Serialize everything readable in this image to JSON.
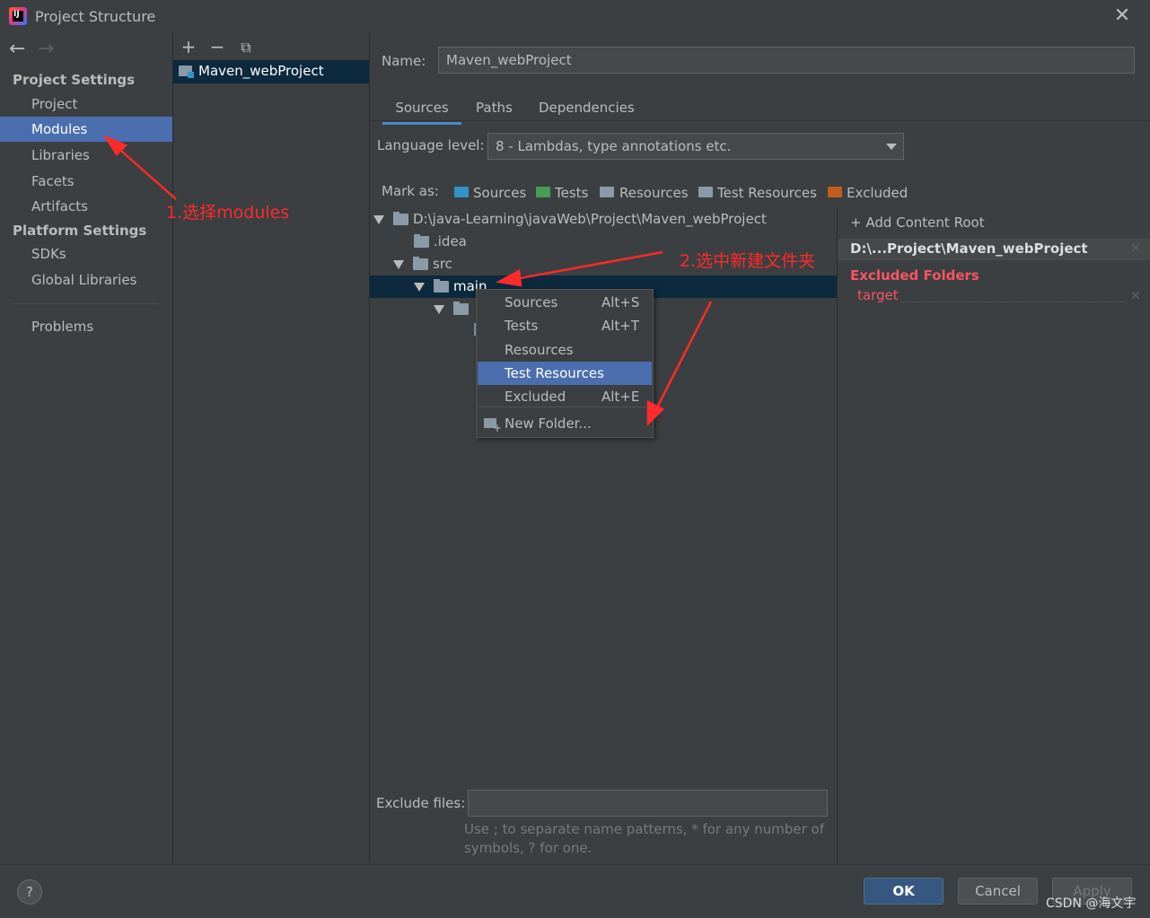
{
  "window": {
    "title": "Project Structure",
    "app_icon_letters": "IJ"
  },
  "nav": {
    "back_icon": "arrow-left-icon",
    "forward_icon": "arrow-right-icon",
    "project_settings_title": "Project Settings",
    "project_settings_items": [
      "Project",
      "Modules",
      "Libraries",
      "Facets",
      "Artifacts"
    ],
    "platform_settings_title": "Platform Settings",
    "platform_settings_items": [
      "SDKs",
      "Global Libraries"
    ],
    "problems": "Problems",
    "selected": "Modules"
  },
  "modules": {
    "toolbar": [
      "add-icon",
      "remove-icon",
      "copy-icon"
    ],
    "items": [
      "Maven_webProject"
    ]
  },
  "main": {
    "name_label": "Name:",
    "name_value": "Maven_webProject",
    "tabs": [
      "Sources",
      "Paths",
      "Dependencies"
    ],
    "active_tab": "Sources",
    "language_level_label": "Language level:",
    "language_level_value": "8 - Lambdas, type annotations etc.",
    "mark_as_label": "Mark as:",
    "mark_as": [
      {
        "label": "Sources",
        "color": "#3592c4"
      },
      {
        "label": "Tests",
        "color": "#499c54"
      },
      {
        "label": "Resources",
        "color": "#8a9aa8"
      },
      {
        "label": "Test Resources",
        "color": "#8a9aa8"
      },
      {
        "label": "Excluded",
        "color": "#c15d1e"
      }
    ],
    "tree": [
      {
        "label": "D:\\java-Learning\\javaWeb\\Project\\Maven_webProject"
      },
      {
        "label": ".idea"
      },
      {
        "label": "src"
      },
      {
        "label": "main"
      },
      {
        "label": ""
      }
    ],
    "content_root": {
      "add_label": "+ Add Content Root",
      "path": "D:\\...Project\\Maven_webProject",
      "excluded_title": "Excluded Folders",
      "excluded_items": [
        "target"
      ]
    },
    "exclude_files_label": "Exclude files:",
    "exclude_files_value": "",
    "hint_line1": "Use ; to separate name patterns, * for any number of",
    "hint_line2": "symbols, ? for one."
  },
  "context_menu": {
    "items": [
      {
        "label": "Sources",
        "shortcut": "Alt+S"
      },
      {
        "label": "Tests",
        "shortcut": "Alt+T"
      },
      {
        "label": "Resources",
        "shortcut": ""
      },
      {
        "label": "Test Resources",
        "shortcut": ""
      },
      {
        "label": "Excluded",
        "shortcut": "Alt+E"
      }
    ],
    "new_folder": "New Folder...",
    "selected": "Test Resources"
  },
  "annotations": {
    "step1": "1.选择modules",
    "step2": "2.选中新建文件夹",
    "color": "#ff2a2a"
  },
  "footer": {
    "help": "?",
    "ok": "OK",
    "cancel": "Cancel",
    "apply": "Apply",
    "watermark": "CSDN @海文宇"
  }
}
